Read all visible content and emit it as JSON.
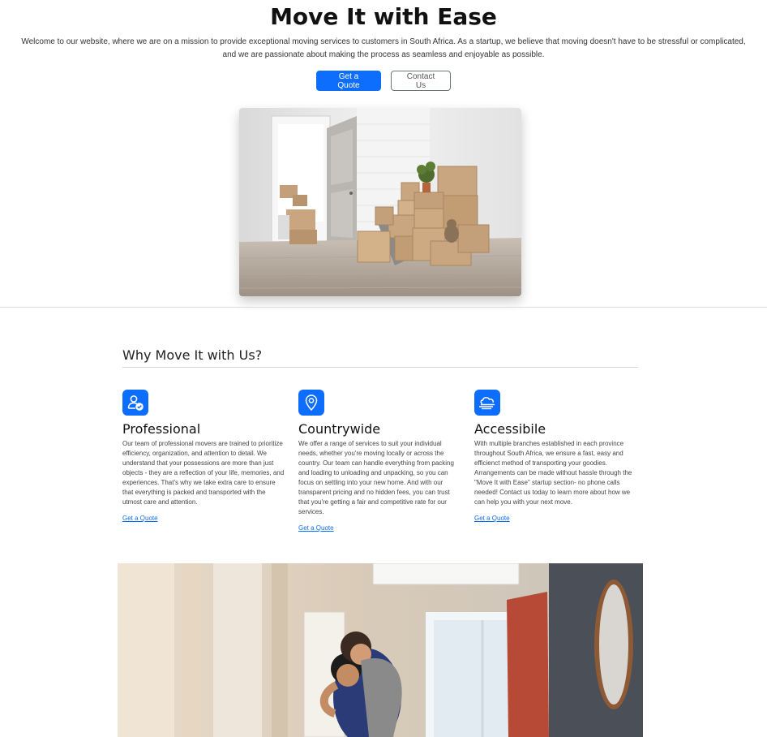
{
  "hero": {
    "title": "Move It with Ease",
    "description": "Welcome to our website, where we are on a mission to provide exceptional moving services to customers in South Africa. As a startup, we believe that moving doesn't have to be stressful or complicated, and we are passionate about making the process as seamless and enjoyable as possible.",
    "primary_button": "Get a Quote",
    "secondary_button": "Contact Us"
  },
  "why": {
    "heading": "Why Move It with Us?",
    "features": [
      {
        "icon": "person-check-icon",
        "title": "Professional",
        "text": "Our team of professional movers are trained to prioritize efficiency, organization, and attention to detail. We understand that your possessions are more than just objects - they are a reflection of your life, memories, and experiences. That's why we take extra care to ensure that everything is packed and transported with the utmost care and attention.",
        "link": "Get a Quote"
      },
      {
        "icon": "geo-pin-icon",
        "title": "Countrywide",
        "text": "We offer a range of services to suit your individual needs, whether you're moving locally or across the country. Our team can handle everything from packing and loading to unloading and unpacking, so you can focus on settling into your new home. And with our transparent pricing and no hidden fees, you can trust that you're getting a fair and competitive rate for our services.",
        "link": "Get a Quote"
      },
      {
        "icon": "cloud-haze-icon",
        "title": "Accessibile",
        "text": "With multiple branches established in each province throughout South Africa, we ensure a fast, easy and efficienct method of transporting your goodies. Arrangements can be made without hassle through the \"Move It with Ease\" startup section- no phone calls needed! Contact us today to learn more about how we can help you with your next move.",
        "link": "Get a Quote"
      }
    ]
  },
  "colors": {
    "accent": "#0d6efd",
    "text": "#212529"
  }
}
